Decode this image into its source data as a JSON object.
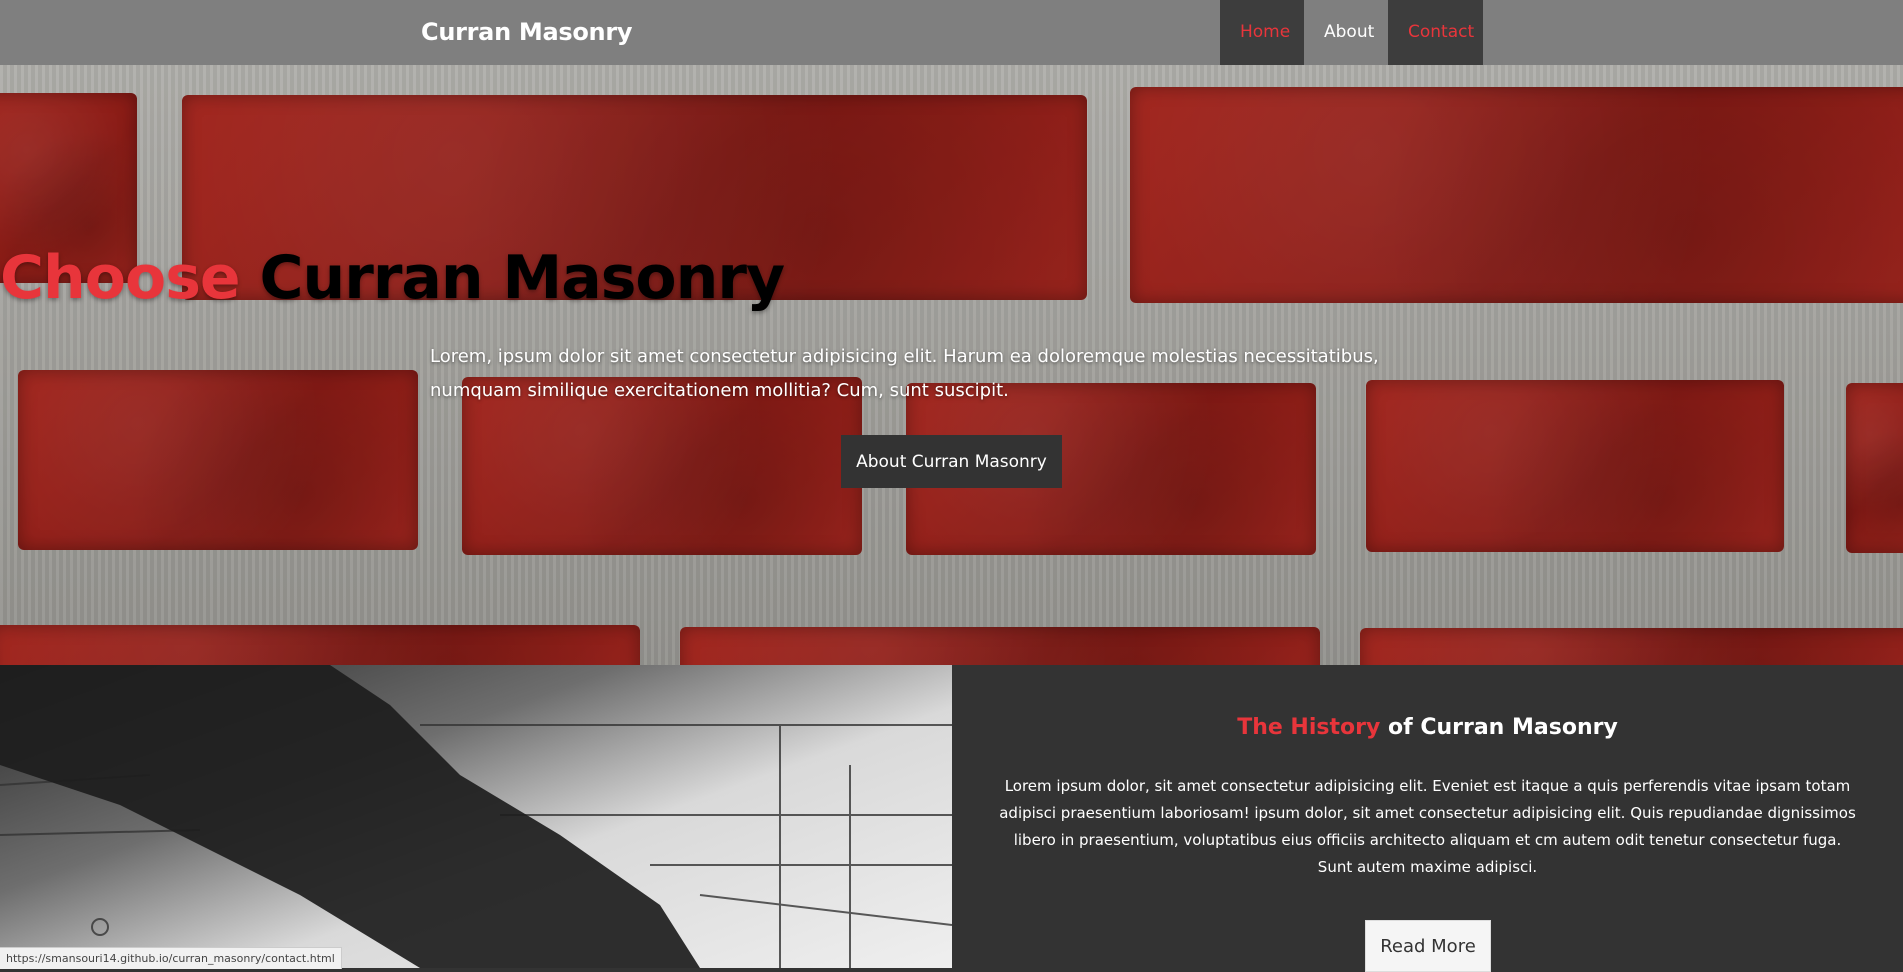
{
  "nav": {
    "brand": "Curran Masonry",
    "links": [
      {
        "label": "Home"
      },
      {
        "label": "About"
      },
      {
        "label": "Contact"
      }
    ]
  },
  "hero": {
    "title_accent": "Choose",
    "title_rest": "Curran Masonry",
    "text": "Lorem, ipsum dolor sit amet consectetur adipisicing elit. Harum ea doloremque molestias necessitatibus, numquam similique exercitationem mollitia? Cum, sunt suscipit.",
    "button_label": "About Curran Masonry"
  },
  "history": {
    "title_accent": "The History",
    "title_rest": "of Curran Masonry",
    "text": "Lorem ipsum dolor, sit amet consectetur adipisicing elit. Eveniet est itaque a quis perferendis vitae ipsam totam adipisci praesentium laboriosam! ipsum dolor, sit amet consectetur adipisicing elit. Quis repudiandae dignissimos libero in praesentium, voluptatibus eius officiis architecto aliquam et cm autem odit tenetur consectetur fuga. Sunt autem maxime adipisci.",
    "button_label": "Read More"
  },
  "status": {
    "url": "https://smansouri14.github.io/curran_masonry/contact.html"
  },
  "colors": {
    "accent": "#e8353b",
    "nav_bg": "#7f7f7f",
    "dark": "#333333"
  }
}
